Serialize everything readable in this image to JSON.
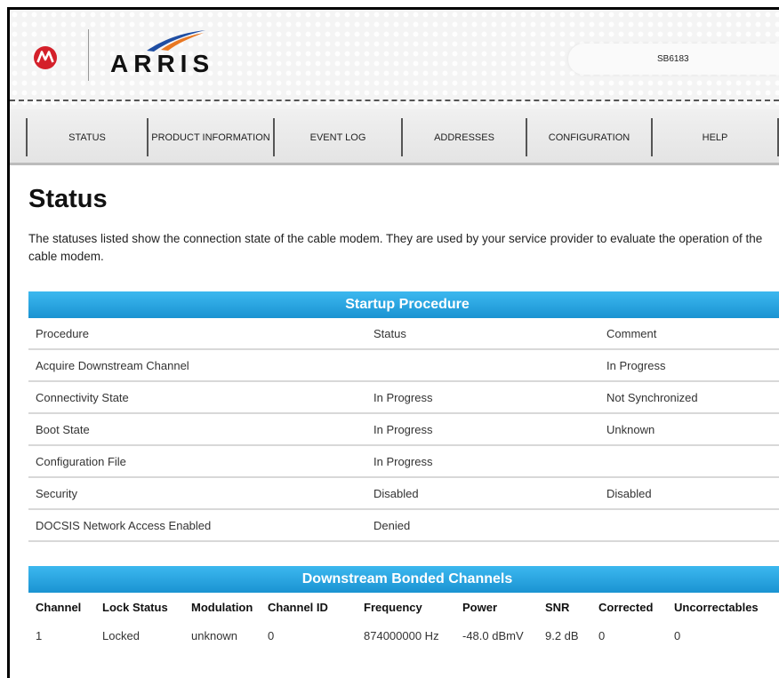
{
  "header": {
    "brand_name": "ARRIS",
    "model": "SB6183",
    "colors": {
      "motorola_red": "#d4202a",
      "arris_blue": "#1f4ea3",
      "arris_orange": "#e87722"
    }
  },
  "nav": {
    "tabs": [
      {
        "label": "STATUS"
      },
      {
        "label": "PRODUCT INFORMATION"
      },
      {
        "label": "EVENT LOG"
      },
      {
        "label": "ADDRESSES"
      },
      {
        "label": "CONFIGURATION"
      },
      {
        "label": "HELP"
      }
    ]
  },
  "page": {
    "title": "Status",
    "intro": "The statuses listed show the connection state of the cable modem. They are used by your service provider to evaluate the operation of the cable modem."
  },
  "startup": {
    "title": "Startup Procedure",
    "headers": [
      "Procedure",
      "Status",
      "Comment"
    ],
    "rows": [
      [
        "Acquire Downstream Channel",
        "",
        "In Progress"
      ],
      [
        "Connectivity State",
        "In Progress",
        "Not Synchronized"
      ],
      [
        "Boot State",
        "In Progress",
        "Unknown"
      ],
      [
        "Configuration File",
        "In Progress",
        ""
      ],
      [
        "Security",
        "Disabled",
        "Disabled"
      ],
      [
        "DOCSIS Network Access Enabled",
        "Denied",
        ""
      ]
    ]
  },
  "downstream": {
    "title": "Downstream Bonded Channels",
    "headers": [
      "Channel",
      "Lock Status",
      "Modulation",
      "Channel ID",
      "Frequency",
      "Power",
      "SNR",
      "Corrected",
      "Uncorrectables"
    ],
    "rows": [
      [
        "1",
        "Locked",
        "unknown",
        "0",
        "874000000 Hz",
        "-48.0 dBmV",
        "9.2 dB",
        "0",
        "0"
      ]
    ]
  },
  "theme": {
    "table_header_blue": "#2aa7e3",
    "row_divider": "#d8d8d8"
  }
}
